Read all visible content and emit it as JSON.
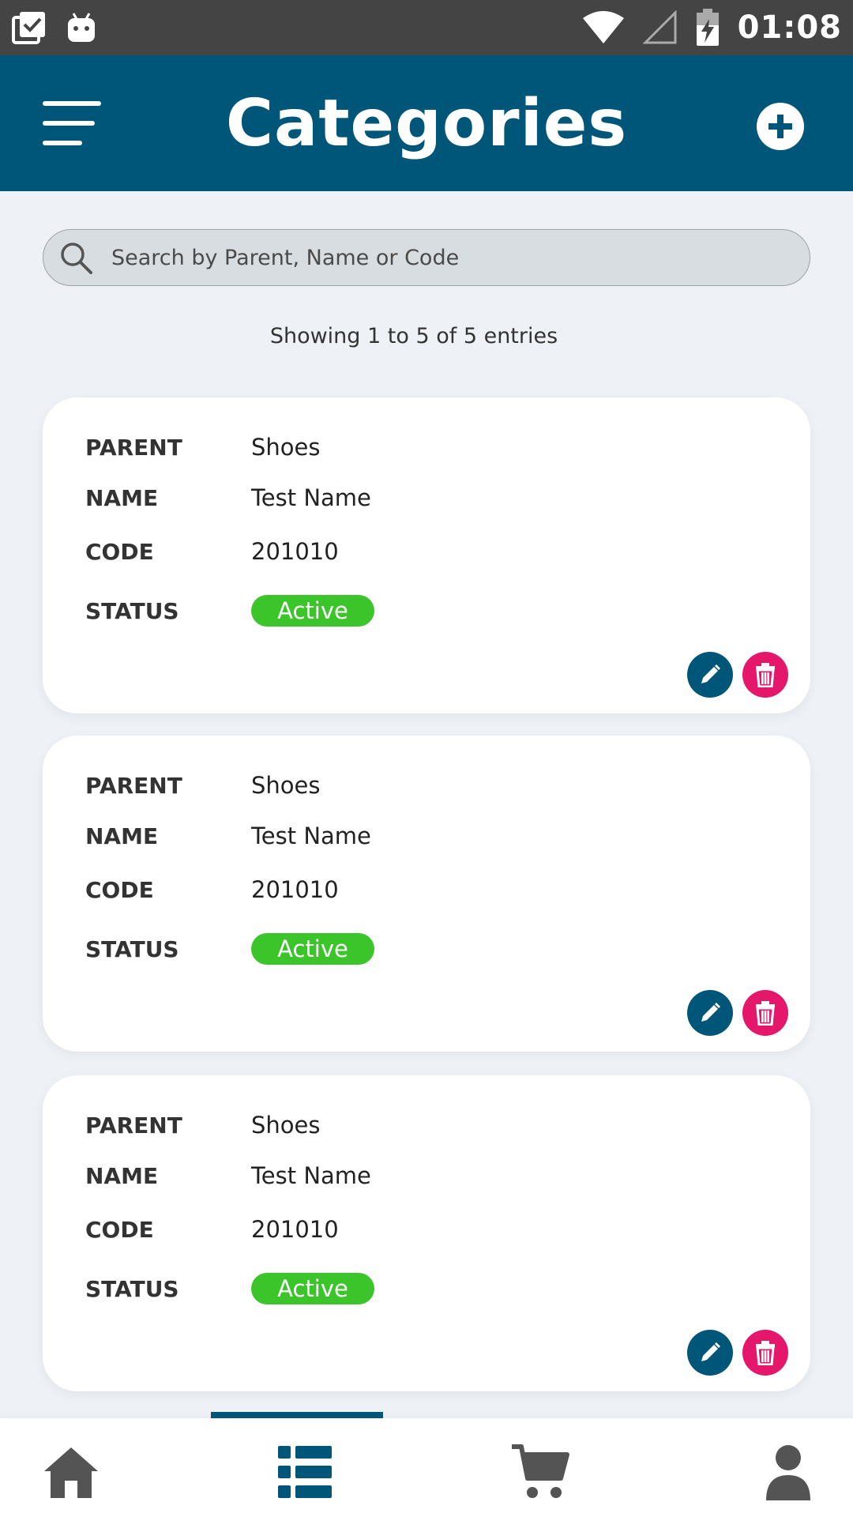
{
  "status_bar": {
    "time": "01:08",
    "icons": [
      "clipboard-check-icon",
      "android-icon",
      "wifi-icon",
      "signal-icon",
      "battery-charging-icon"
    ]
  },
  "header": {
    "title": "Categories",
    "menu_icon": "hamburger-menu-icon",
    "add_icon": "plus-circle-icon"
  },
  "search": {
    "placeholder": "Search by Parent, Name or Code",
    "value": ""
  },
  "entries_info": "Showing 1 to 5 of 5 entries",
  "labels": {
    "parent": "PARENT",
    "name": "NAME",
    "code": "CODE",
    "status": "STATUS"
  },
  "categories": [
    {
      "parent": "Shoes",
      "name": "Test Name",
      "code": "201010",
      "status": "Active"
    },
    {
      "parent": "Shoes",
      "name": "Test Name",
      "code": "201010",
      "status": "Active"
    },
    {
      "parent": "Shoes",
      "name": "Test Name",
      "code": "201010",
      "status": "Active"
    }
  ],
  "bottom_nav": {
    "active": "categories",
    "items": [
      "home-icon",
      "list-icon",
      "cart-icon",
      "profile-icon"
    ]
  },
  "colors": {
    "primary": "#005678",
    "status_active": "#3cc42b",
    "delete": "#e5176b",
    "nav_icon": "#545454"
  }
}
